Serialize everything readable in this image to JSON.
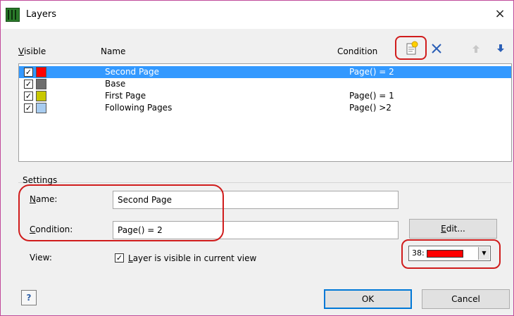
{
  "window": {
    "title": "Layers",
    "close_glyph": "×",
    "icon": "layers-app-icon"
  },
  "headers": {
    "visible_prefix": "V",
    "visible_rest": "isible",
    "name": "Name",
    "condition": "Condition"
  },
  "toolbar": {
    "new_icon": "new-layer-icon",
    "delete_icon": "delete-icon",
    "move_up_icon": "arrow-up-icon",
    "move_down_icon": "arrow-down-icon"
  },
  "layers": [
    {
      "name": "Second Page",
      "condition": "Page() = 2",
      "color": "#ff0000",
      "checked": "✓",
      "selected": true
    },
    {
      "name": "Base",
      "condition": "",
      "color": "#6e6e6e",
      "checked": "✓",
      "selected": false
    },
    {
      "name": "First Page",
      "condition": "Page() = 1",
      "color": "#c8c800",
      "checked": "✓",
      "selected": false
    },
    {
      "name": "Following Pages",
      "condition": "Page() >2",
      "color": "#a8ccf0",
      "checked": "✓",
      "selected": false
    }
  ],
  "settings": {
    "group_label": "Settings",
    "name_label_prefix": "N",
    "name_label_rest": "ame:",
    "name_value": "Second Page",
    "condition_label_prefix": "C",
    "condition_label_rest": "ondition:",
    "condition_value": "Page() = 2",
    "edit_prefix": "E",
    "edit_rest": "dit...",
    "view_label": "View:",
    "visible_check": "✓",
    "visible_prefix": "L",
    "visible_rest": "ayer is visible in current view",
    "color_index": "38:",
    "color_value": "#ff0000",
    "dropdown_glyph": "▼"
  },
  "buttons": {
    "help": "?",
    "ok": "OK",
    "cancel": "Cancel"
  },
  "colors": {
    "annotation": "#d01c1c",
    "selection": "#3399ff"
  }
}
